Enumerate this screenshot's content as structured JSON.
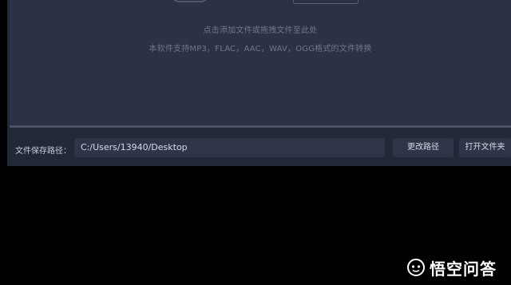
{
  "drop_zone": {
    "hint_primary": "点击添加文件或拖拽文件至此处",
    "hint_formats": "本软件支持MP3，FLAC，AAC，WAV，OGG格式的文件转换"
  },
  "bottom_bar": {
    "save_path_label": "文件保存路径：",
    "save_path_value": "C:/Users/13940/Desktop",
    "change_path_label": "更改路径",
    "open_folder_label": "打开文件夹"
  },
  "watermark": {
    "text": "悟空问答"
  },
  "colors": {
    "background": "#000000",
    "panel": "#232838",
    "drop_zone": "#2c3246",
    "hint_text": "#6f778c",
    "control": "#2f3549"
  }
}
